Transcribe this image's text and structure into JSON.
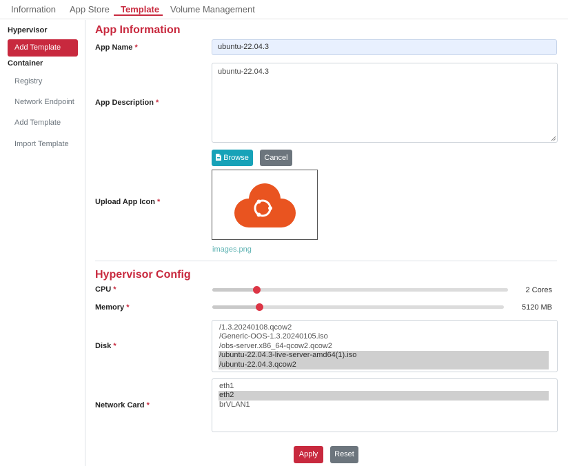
{
  "top_tabs": [
    {
      "label": "Information"
    },
    {
      "label": "App Store"
    },
    {
      "label": "Template"
    },
    {
      "label": "Volume Management"
    }
  ],
  "sidebar": {
    "hypervisor_heading": "Hypervisor",
    "hypervisor_items": [
      {
        "label": "Add Template"
      }
    ],
    "container_heading": "Container",
    "container_items": [
      {
        "label": "Registry"
      },
      {
        "label": "Network Endpoint"
      },
      {
        "label": "Add Template"
      },
      {
        "label": "Import Template"
      }
    ]
  },
  "app_info": {
    "title": "App Information",
    "name_label": "App Name",
    "name_value": "ubuntu-22.04.3",
    "description_label": "App Description",
    "description_value": "ubuntu-22.04.3",
    "browse_label": "Browse",
    "cancel_label": "Cancel",
    "icon_label": "Upload App Icon",
    "icon_file": "images.png"
  },
  "hypervisor_config": {
    "title": "Hypervisor Config",
    "cpu_label": "CPU",
    "cpu_value": "2 Cores",
    "cpu_level": 0.15,
    "memory_label": "Memory",
    "memory_value": "5120 MB",
    "memory_level": 0.16,
    "disk_label": "Disk",
    "disks": [
      {
        "label": "/1.3.20240108.qcow2",
        "selected": false
      },
      {
        "label": "/Generic-OOS-1.3.20240105.iso",
        "selected": false
      },
      {
        "label": "/obs-server.x86_64-qcow2.qcow2",
        "selected": false
      },
      {
        "label": "/ubuntu-22.04.3-live-server-amd64(1).iso",
        "selected": true
      },
      {
        "label": "/ubuntu-22.04.3.qcow2",
        "selected": true
      }
    ],
    "network_label": "Network Card",
    "networks": [
      {
        "label": "eth1",
        "selected": false
      },
      {
        "label": "eth2",
        "selected": true
      },
      {
        "label": "brVLAN1",
        "selected": false
      }
    ]
  },
  "actions": {
    "apply_label": "Apply",
    "reset_label": "Reset"
  },
  "colors": {
    "accent": "#c8293e",
    "info": "#17a2b8",
    "secondary": "#6c757d",
    "logo": "#e95420"
  },
  "icons": {
    "browse": "file-icon",
    "app_icon": "ubuntu-cloud-icon"
  }
}
